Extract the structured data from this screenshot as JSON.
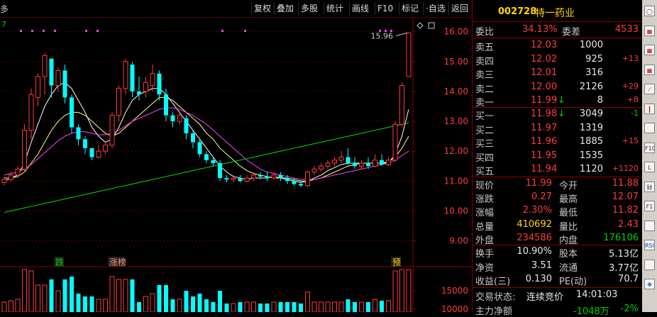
{
  "toolbar": {
    "left_label": "多",
    "green_label": "7",
    "buttons": [
      "复权",
      "叠加",
      "多股",
      "统计",
      "画线",
      "F10",
      "标记",
      "·自选",
      "返回"
    ]
  },
  "chart_data": {
    "type": "candlestick",
    "y_ticks_main": [
      "16.00",
      "15.00",
      "14.00",
      "13.00",
      "12.00",
      "11.00",
      "10.00",
      "9.00"
    ],
    "ylim_main": [
      8.75,
      16.35
    ],
    "y_ticks_volume": [
      "15000",
      "10000"
    ],
    "annotation_high": "15.96",
    "markers": [
      {
        "label": "跌",
        "color": "#00d000"
      },
      {
        "label": "涨榜",
        "color": "#ff9070"
      },
      {
        "label": "预",
        "color": "#ffd700"
      }
    ],
    "candles": [
      {
        "o": 10.95,
        "c": 11.05,
        "h": 11.15,
        "l": 10.85
      },
      {
        "o": 11.05,
        "c": 11.2,
        "h": 11.3,
        "l": 11.0
      },
      {
        "o": 11.2,
        "c": 11.4,
        "h": 11.5,
        "l": 11.1
      },
      {
        "o": 11.4,
        "c": 12.7,
        "h": 12.9,
        "l": 11.3
      },
      {
        "o": 12.7,
        "c": 13.9,
        "h": 14.1,
        "l": 12.4
      },
      {
        "o": 13.8,
        "c": 14.5,
        "h": 14.6,
        "l": 13.5
      },
      {
        "o": 14.5,
        "c": 15.2,
        "h": 15.3,
        "l": 13.9
      },
      {
        "o": 15.1,
        "c": 14.2,
        "h": 15.1,
        "l": 13.8
      },
      {
        "o": 14.2,
        "c": 14.7,
        "h": 14.8,
        "l": 14.0
      },
      {
        "o": 14.7,
        "c": 13.8,
        "h": 14.9,
        "l": 13.6
      },
      {
        "o": 13.8,
        "c": 12.8,
        "h": 13.9,
        "l": 12.6
      },
      {
        "o": 12.8,
        "c": 12.4,
        "h": 12.9,
        "l": 12.2
      },
      {
        "o": 12.4,
        "c": 12.1,
        "h": 12.5,
        "l": 11.9
      },
      {
        "o": 12.1,
        "c": 11.8,
        "h": 12.1,
        "l": 11.7
      },
      {
        "o": 11.8,
        "c": 12.0,
        "h": 12.2,
        "l": 11.75
      },
      {
        "o": 12.0,
        "c": 12.2,
        "h": 12.3,
        "l": 11.9
      },
      {
        "o": 12.2,
        "c": 13.2,
        "h": 13.3,
        "l": 12.1
      },
      {
        "o": 13.2,
        "c": 14.1,
        "h": 14.2,
        "l": 13.0
      },
      {
        "o": 14.1,
        "c": 15.0,
        "h": 15.1,
        "l": 13.9
      },
      {
        "o": 14.9,
        "c": 14.0,
        "h": 15.0,
        "l": 13.8
      },
      {
        "o": 14.0,
        "c": 13.9,
        "h": 14.5,
        "l": 13.7
      },
      {
        "o": 14.0,
        "c": 14.3,
        "h": 14.5,
        "l": 13.8
      },
      {
        "o": 14.2,
        "c": 14.6,
        "h": 14.9,
        "l": 14.0
      },
      {
        "o": 14.6,
        "c": 13.9,
        "h": 14.7,
        "l": 13.7
      },
      {
        "o": 13.9,
        "c": 13.2,
        "h": 14.1,
        "l": 13.0
      },
      {
        "o": 13.2,
        "c": 13.0,
        "h": 13.3,
        "l": 12.8
      },
      {
        "o": 13.0,
        "c": 13.2,
        "h": 13.3,
        "l": 12.9
      },
      {
        "o": 13.1,
        "c": 12.6,
        "h": 13.2,
        "l": 12.4
      },
      {
        "o": 12.6,
        "c": 12.3,
        "h": 12.7,
        "l": 12.1
      },
      {
        "o": 12.3,
        "c": 11.9,
        "h": 12.4,
        "l": 11.8
      },
      {
        "o": 11.9,
        "c": 11.7,
        "h": 12.0,
        "l": 11.6
      },
      {
        "o": 11.7,
        "c": 11.6,
        "h": 11.8,
        "l": 11.5
      },
      {
        "o": 11.6,
        "c": 11.1,
        "h": 11.7,
        "l": 11.0
      },
      {
        "o": 11.1,
        "c": 11.05,
        "h": 11.2,
        "l": 10.95
      },
      {
        "o": 11.05,
        "c": 11.1,
        "h": 11.2,
        "l": 10.95
      },
      {
        "o": 11.1,
        "c": 11.0,
        "h": 11.2,
        "l": 10.95
      },
      {
        "o": 11.0,
        "c": 11.1,
        "h": 11.2,
        "l": 10.95
      },
      {
        "o": 11.1,
        "c": 11.2,
        "h": 11.3,
        "l": 11.0
      },
      {
        "o": 11.2,
        "c": 11.15,
        "h": 11.3,
        "l": 11.05
      },
      {
        "o": 11.15,
        "c": 11.1,
        "h": 11.3,
        "l": 11.0
      },
      {
        "o": 11.1,
        "c": 11.2,
        "h": 11.3,
        "l": 11.05
      },
      {
        "o": 11.2,
        "c": 11.1,
        "h": 11.3,
        "l": 11.0
      },
      {
        "o": 11.1,
        "c": 11.0,
        "h": 11.2,
        "l": 10.9
      },
      {
        "o": 11.0,
        "c": 10.9,
        "h": 11.1,
        "l": 10.85
      },
      {
        "o": 10.9,
        "c": 10.85,
        "h": 11.0,
        "l": 10.8
      },
      {
        "o": 10.85,
        "c": 11.3,
        "h": 11.35,
        "l": 10.8
      },
      {
        "o": 11.3,
        "c": 11.4,
        "h": 11.5,
        "l": 11.2
      },
      {
        "o": 11.4,
        "c": 11.5,
        "h": 11.6,
        "l": 11.3
      },
      {
        "o": 11.5,
        "c": 11.6,
        "h": 11.7,
        "l": 11.4
      },
      {
        "o": 11.6,
        "c": 11.7,
        "h": 11.8,
        "l": 11.5
      },
      {
        "o": 11.7,
        "c": 11.8,
        "h": 12.0,
        "l": 11.6
      },
      {
        "o": 11.8,
        "c": 11.6,
        "h": 12.1,
        "l": 11.55
      },
      {
        "o": 11.6,
        "c": 11.5,
        "h": 11.8,
        "l": 11.4
      },
      {
        "o": 11.5,
        "c": 11.6,
        "h": 11.7,
        "l": 11.4
      },
      {
        "o": 11.6,
        "c": 11.5,
        "h": 11.8,
        "l": 11.4
      },
      {
        "o": 11.5,
        "c": 11.7,
        "h": 11.9,
        "l": 11.45
      },
      {
        "o": 11.7,
        "c": 11.55,
        "h": 11.9,
        "l": 11.5
      },
      {
        "o": 11.55,
        "c": 11.7,
        "h": 11.8,
        "l": 11.5
      },
      {
        "o": 11.7,
        "c": 12.9,
        "h": 13.0,
        "l": 11.65
      },
      {
        "o": 12.9,
        "c": 14.2,
        "h": 14.3,
        "l": 12.8
      },
      {
        "o": 14.5,
        "c": 15.96,
        "h": 15.96,
        "l": 14.5
      }
    ],
    "ma_lines": [
      {
        "color": "#ffffff",
        "values": [
          11.0,
          11.1,
          11.2,
          11.6,
          12.3,
          12.9,
          13.5,
          13.9,
          14.2,
          14.3,
          14.1,
          13.7,
          13.3,
          12.8,
          12.5,
          12.3,
          12.4,
          12.8,
          13.3,
          13.7,
          13.9,
          14.0,
          14.1,
          14.1,
          13.9,
          13.6,
          13.3,
          13.0,
          12.7,
          12.4,
          12.1,
          11.8,
          11.5,
          11.3,
          11.15,
          11.1,
          11.05,
          11.1,
          11.1,
          11.1,
          11.15,
          11.1,
          11.05,
          11.0,
          10.95,
          11.0,
          11.1,
          11.2,
          11.35,
          11.45,
          11.55,
          11.6,
          11.6,
          11.6,
          11.6,
          11.6,
          11.6,
          11.6,
          11.9,
          12.5,
          13.4
        ]
      },
      {
        "color": "#ffff80",
        "values": [
          11.1,
          11.1,
          11.15,
          11.3,
          11.6,
          11.9,
          12.3,
          12.7,
          13.0,
          13.2,
          13.3,
          13.3,
          13.2,
          13.0,
          12.8,
          12.6,
          12.5,
          12.6,
          12.8,
          13.0,
          13.2,
          13.4,
          13.6,
          13.8,
          13.8,
          13.7,
          13.5,
          13.3,
          13.1,
          12.9,
          12.6,
          12.4,
          12.1,
          11.9,
          11.7,
          11.5,
          11.35,
          11.25,
          11.2,
          11.15,
          11.1,
          11.1,
          11.1,
          11.05,
          11.0,
          11.0,
          11.05,
          11.1,
          11.2,
          11.3,
          11.4,
          11.5,
          11.55,
          11.6,
          11.6,
          11.6,
          11.6,
          11.65,
          11.8,
          12.1,
          12.5
        ]
      },
      {
        "color": "#ff40ff",
        "values": [
          11.2,
          11.25,
          11.3,
          11.4,
          11.55,
          11.75,
          11.95,
          12.15,
          12.35,
          12.5,
          12.6,
          12.65,
          12.65,
          12.6,
          12.55,
          12.55,
          12.6,
          12.7,
          12.85,
          13.0,
          13.1,
          13.2,
          13.3,
          13.4,
          13.45,
          13.45,
          13.4,
          13.3,
          13.2,
          13.05,
          12.9,
          12.7,
          12.5,
          12.3,
          12.1,
          11.9,
          11.7,
          11.55,
          11.4,
          11.3,
          11.25,
          11.2,
          11.15,
          11.1,
          11.05,
          11.05,
          11.05,
          11.1,
          11.15,
          11.2,
          11.25,
          11.3,
          11.35,
          11.4,
          11.45,
          11.5,
          11.55,
          11.6,
          11.7,
          11.85,
          12.0
        ]
      },
      {
        "color": "#00e000",
        "values": [
          9.95,
          10.0,
          10.05,
          10.1,
          10.15,
          10.2,
          10.25,
          10.3,
          10.35,
          10.4,
          10.45,
          10.5,
          10.55,
          10.6,
          10.65,
          10.7,
          10.75,
          10.8,
          10.85,
          10.9,
          10.95,
          11.0,
          11.05,
          11.1,
          11.15,
          11.2,
          11.25,
          11.3,
          11.35,
          11.4,
          11.45,
          11.5,
          11.55,
          11.6,
          11.65,
          11.7,
          11.75,
          11.8,
          11.85,
          11.9,
          11.95,
          12.0,
          12.05,
          12.1,
          12.15,
          12.2,
          12.25,
          12.3,
          12.35,
          12.4,
          12.45,
          12.5,
          12.55,
          12.6,
          12.65,
          12.7,
          12.75,
          12.8,
          12.85,
          12.9,
          12.95
        ]
      }
    ]
  },
  "panel": {
    "code": "002728",
    "name": "特一药业",
    "weibi_label": "委比",
    "weibi_value": "34.13%",
    "weicha_label": "委差",
    "weicha_value": "4533",
    "asks": [
      {
        "label": "卖五",
        "price": "12.03",
        "vol": "1000",
        "chg": "",
        "arrow": ""
      },
      {
        "label": "卖四",
        "price": "12.02",
        "vol": "925",
        "chg": "+13",
        "arrow": ""
      },
      {
        "label": "卖三",
        "price": "12.01",
        "vol": "316",
        "chg": "",
        "arrow": ""
      },
      {
        "label": "卖二",
        "price": "12.00",
        "vol": "2126",
        "chg": "+29",
        "arrow": ""
      },
      {
        "label": "卖一",
        "price": "11.99",
        "vol": "8",
        "chg": "+8",
        "arrow": "↓"
      }
    ],
    "bids": [
      {
        "label": "买一",
        "price": "11.98",
        "vol": "3049",
        "chg": "-1",
        "arrow": "↓"
      },
      {
        "label": "买二",
        "price": "11.97",
        "vol": "1319",
        "chg": "",
        "arrow": ""
      },
      {
        "label": "买三",
        "price": "11.96",
        "vol": "1885",
        "chg": "+15",
        "arrow": ""
      },
      {
        "label": "买四",
        "price": "11.95",
        "vol": "1535",
        "chg": "",
        "arrow": ""
      },
      {
        "label": "买五",
        "price": "11.94",
        "vol": "1120",
        "chg": "+1120",
        "arrow": ""
      }
    ],
    "quote": [
      {
        "l1": "现价",
        "v1": "11.99",
        "l2": "今开",
        "v2": "11.88"
      },
      {
        "l1": "涨跌",
        "v1": "0.27",
        "l2": "最高",
        "v2": "12.07"
      },
      {
        "l1": "涨幅",
        "v1": "2.30%",
        "l2": "最低",
        "v2": "11.82"
      },
      {
        "l1": "总量",
        "v1": "410692",
        "l2": "量比",
        "v2": "2.43"
      },
      {
        "l1": "外盘",
        "v1": "234586",
        "l2": "内盘",
        "v2": "176106"
      }
    ],
    "fund": [
      {
        "l1": "换手",
        "v1": "10.90%",
        "l2": "股本",
        "v2": "5.13亿"
      },
      {
        "l1": "净资",
        "v1": "3.51",
        "l2": "流通",
        "v2": "3.77亿"
      },
      {
        "l1": "收益(三)",
        "v1": "0.130",
        "l2": "PE(动)",
        "v2": "70.7"
      }
    ],
    "status_label": "交易状态:",
    "status_value": "连续竞价",
    "status_time": "14:01:03",
    "flow_label": "主力净额",
    "flow_value": "-1048万",
    "flow_pct": "-2%"
  },
  "side_icons": [
    "restore-icon",
    "grid-icon",
    "list-icon",
    "table-icon",
    "trend-icon",
    "kline-icon",
    "tick-icon",
    "f10-icon",
    "level2-icon",
    "finance-icon",
    "f1-icon",
    "chart-icon",
    "rsi-icon",
    "scale-icon",
    "move-icon"
  ],
  "side_labels": [
    "",
    "",
    "",
    "",
    "",
    "",
    "",
    "F10",
    "L",
    "财",
    "F1",
    "",
    "RSI",
    "",
    ""
  ]
}
